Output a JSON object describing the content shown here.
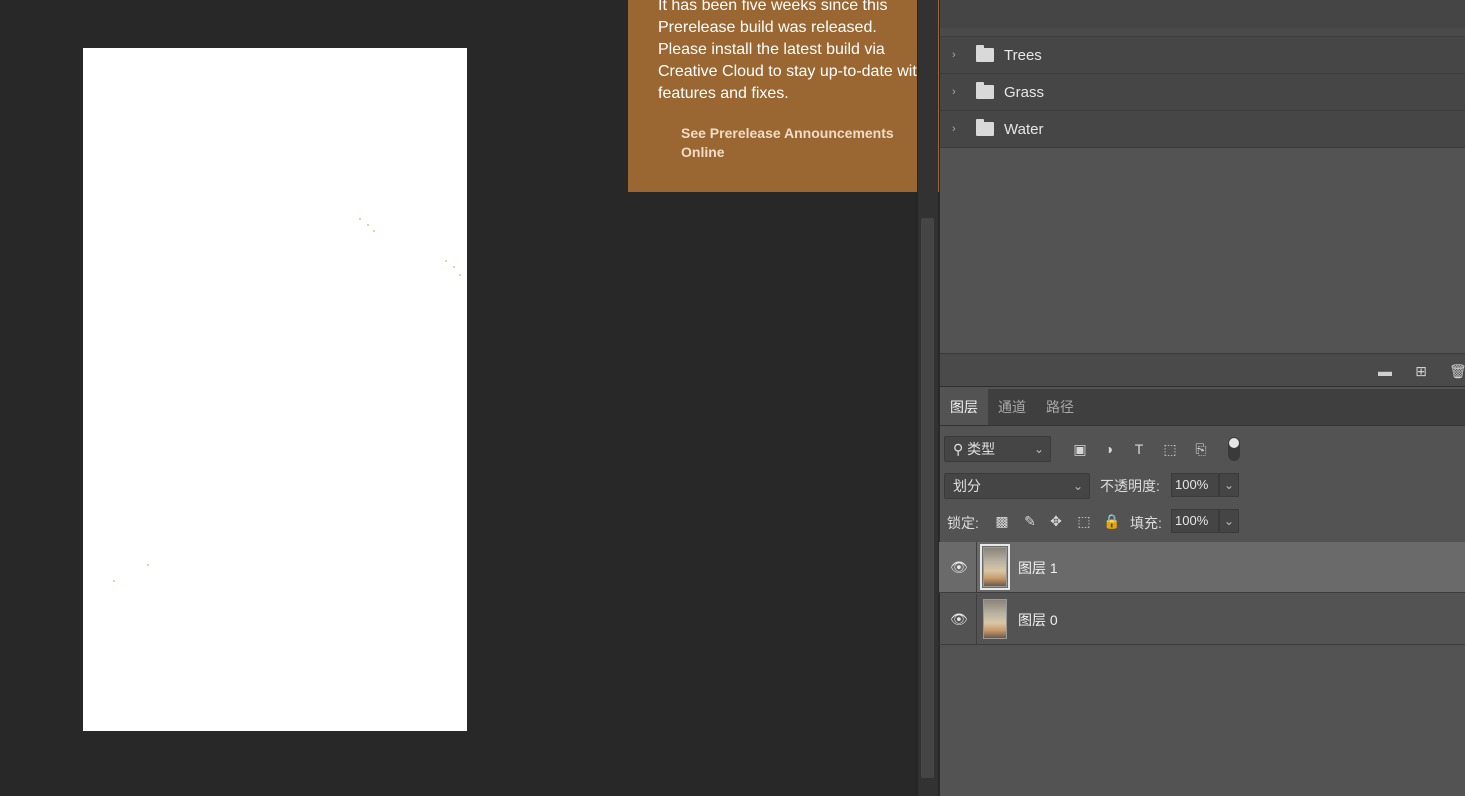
{
  "notification": {
    "message": "It has been five weeks since this Prerelease build was released. Please install the latest build via Creative Cloud to stay up-to-date with features and fixes.",
    "link": "See Prerelease Announcements Online"
  },
  "groups": [
    {
      "label": "Trees",
      "icon": "folder-icon"
    },
    {
      "label": "Grass",
      "icon": "folder-icon"
    },
    {
      "label": "Water",
      "icon": "folder-icon"
    }
  ],
  "tabs": [
    {
      "label": "图层",
      "active": true
    },
    {
      "label": "通道",
      "active": false
    },
    {
      "label": "路径",
      "active": false
    }
  ],
  "filter": {
    "kind_label": "类型",
    "icons": [
      "image-filter-icon",
      "adjustment-filter-icon",
      "type-filter-icon",
      "shape-filter-icon",
      "smart-object-filter-icon"
    ]
  },
  "blend": {
    "mode": "划分",
    "opacity_label": "不透明度:",
    "opacity_value": "100%",
    "lock_label": "锁定:",
    "fill_label": "填充:",
    "fill_value": "100%"
  },
  "layers": [
    {
      "name": "图层 1",
      "visible": true,
      "selected": true
    },
    {
      "name": "图层 0",
      "visible": true,
      "selected": false
    }
  ],
  "colors": {
    "workspace": "#282828",
    "panel": "#535353",
    "notification": "#9a6632",
    "selected_layer": "#6a6a6a"
  }
}
